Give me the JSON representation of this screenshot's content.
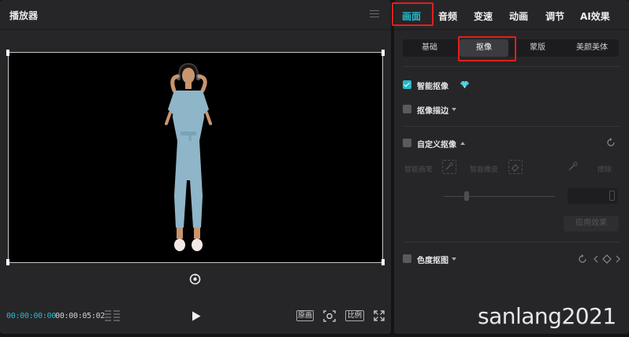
{
  "player": {
    "title": "播放器",
    "timecode_current": "00:00:00:00",
    "timecode_total": "00:00:05:02",
    "controls": [
      "原画",
      "比例"
    ]
  },
  "side": {
    "main_tabs": [
      {
        "label": "画面",
        "active": true
      },
      {
        "label": "音频",
        "active": false
      },
      {
        "label": "变速",
        "active": false
      },
      {
        "label": "动画",
        "active": false
      },
      {
        "label": "调节",
        "active": false
      },
      {
        "label": "AI效果",
        "active": false
      }
    ],
    "sub_tabs": [
      {
        "label": "基础",
        "active": false
      },
      {
        "label": "抠像",
        "active": true
      },
      {
        "label": "蒙版",
        "active": false
      },
      {
        "label": "美颜美体",
        "active": false
      }
    ],
    "smart_cutout": {
      "label": "智能抠像",
      "checked": true
    },
    "cutout_stroke": {
      "label": "抠像描边",
      "checked": false
    },
    "custom_cutout": {
      "label": "自定义抠像",
      "checked": false
    },
    "custom_tools": [
      "智能画笔",
      "智能橡皮",
      "擦除"
    ],
    "apply_label": "应用效果",
    "chroma_key": {
      "label": "色度抠图",
      "checked": false
    }
  },
  "watermark": "sanlang2021",
  "colors": {
    "accent": "#27b9c8",
    "highlight_box": "#e0201e",
    "panel_bg": "#262628",
    "app_bg": "#141414"
  }
}
